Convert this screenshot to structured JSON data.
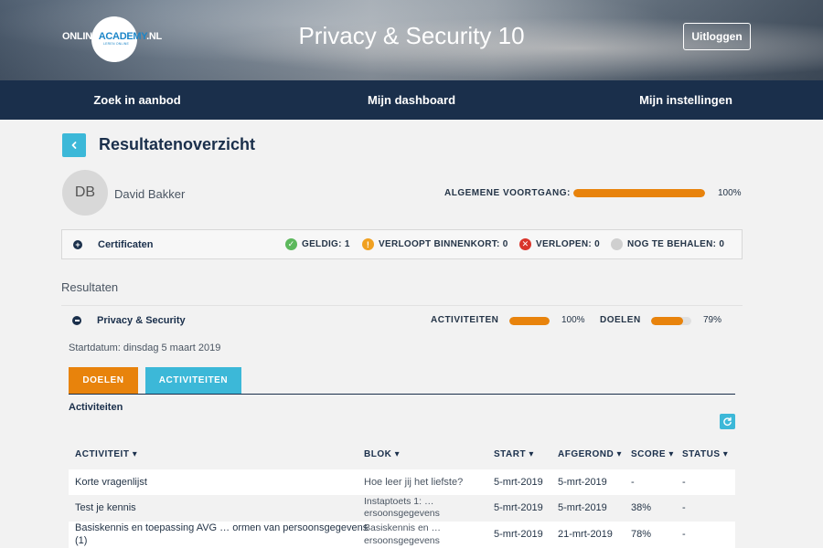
{
  "header": {
    "logo_prefix": "ONLINE",
    "logo_accent": "ACADEMY",
    "logo_suffix": ".NL",
    "logo_tagline": "LEREN ONLINE",
    "title": "Privacy & Security 10",
    "logout_label": "Uitloggen"
  },
  "nav": {
    "items": [
      {
        "label": "Zoek in aanbod"
      },
      {
        "label": "Mijn dashboard"
      },
      {
        "label": "Mijn instellingen"
      }
    ]
  },
  "page": {
    "title": "Resultatenoverzicht",
    "back_icon": "chevron-left-icon"
  },
  "user": {
    "initials": "DB",
    "name": "David Bakker",
    "progress_label": "ALGEMENE VOORTGANG:",
    "progress_value": 1.0,
    "progress_text": "100%"
  },
  "certificates": {
    "label": "Certificaten",
    "stats": [
      {
        "label": "GELDIG: 1",
        "icon": "check-circle-icon",
        "color": "#5cb85c"
      },
      {
        "label": "VERLOOPT BINNENKORT: 0",
        "icon": "warning-circle-icon",
        "color": "#f0a020"
      },
      {
        "label": "VERLOPEN: 0",
        "icon": "x-circle-icon",
        "color": "#d9342b"
      },
      {
        "label": "NOG TE BEHALEN: 0",
        "icon": "grey-circle-icon",
        "color": "#cfcfcf"
      }
    ]
  },
  "results": {
    "section_label": "Resultaten",
    "course": {
      "name": "Privacy & Security",
      "activities_label": "ACTIVITEITEN",
      "activities_value": 1.0,
      "activities_text": "100%",
      "goals_label": "DOELEN",
      "goals_value": 0.79,
      "goals_text": "79%",
      "startdate": "Startdatum: dinsdag 5 maart 2019"
    },
    "tabs": [
      {
        "label": "DOELEN",
        "color": "#e8830c"
      },
      {
        "label": "ACTIVITEITEN",
        "color": "#3cb8d8"
      }
    ],
    "sub_title": "Activiteiten",
    "columns": [
      "ACTIVITEIT ▾",
      "BLOK ▾",
      "START ▾",
      "AFGEROND ▾",
      "SCORE ▾",
      "STATUS ▾"
    ],
    "rows": [
      {
        "activity": "Korte vragenlijst",
        "activity2": "",
        "block": "Hoe leer jij het liefste?",
        "block2": "",
        "start": "5-mrt-2019",
        "done": "5-mrt-2019",
        "score": "-",
        "status": "-"
      },
      {
        "activity": "Test je kennis",
        "activity2": "",
        "block": "Instaptoets 1: …",
        "block2": "ersoonsgegevens",
        "start": "5-mrt-2019",
        "done": "5-mrt-2019",
        "score": "38%",
        "status": "-"
      },
      {
        "activity": "Basiskennis en toepassing AVG … ormen van persoonsgegevens",
        "activity2": "(1)",
        "block": "Basiskennis en …",
        "block2": "ersoonsgegevens",
        "start": "5-mrt-2019",
        "done": "21-mrt-2019",
        "score": "78%",
        "status": "-"
      }
    ]
  }
}
